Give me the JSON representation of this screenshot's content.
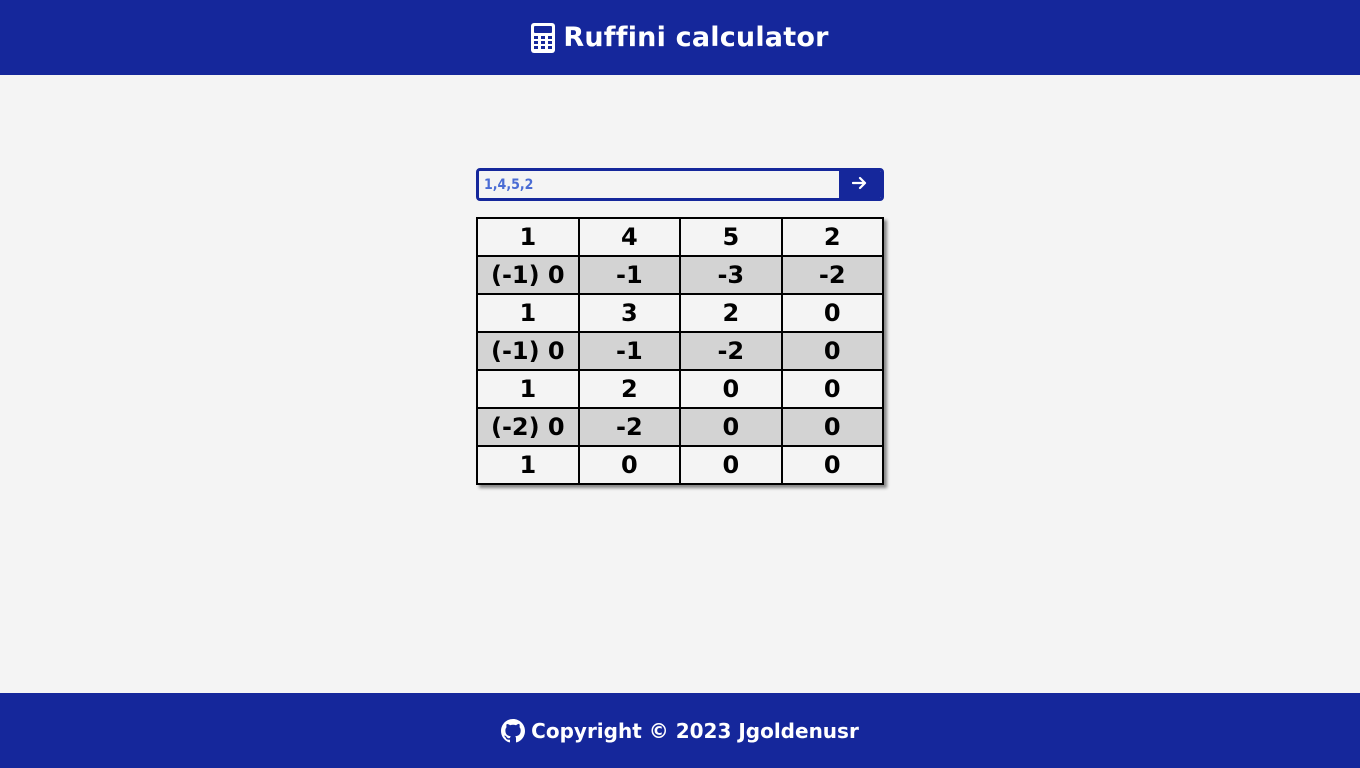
{
  "header": {
    "title": "Ruffini calculator",
    "icon": "calculator-icon"
  },
  "search": {
    "value": "1,4,5,2",
    "submit_icon": "arrow-right-icon"
  },
  "table": {
    "rows": [
      {
        "shaded": false,
        "cells": [
          "1",
          "4",
          "5",
          "2"
        ]
      },
      {
        "shaded": true,
        "cells": [
          "(-1) 0",
          "-1",
          "-3",
          "-2"
        ]
      },
      {
        "shaded": false,
        "cells": [
          "1",
          "3",
          "2",
          "0"
        ]
      },
      {
        "shaded": true,
        "cells": [
          "(-1) 0",
          "-1",
          "-2",
          "0"
        ]
      },
      {
        "shaded": false,
        "cells": [
          "1",
          "2",
          "0",
          "0"
        ]
      },
      {
        "shaded": true,
        "cells": [
          "(-2) 0",
          "-2",
          "0",
          "0"
        ]
      },
      {
        "shaded": false,
        "cells": [
          "1",
          "0",
          "0",
          "0"
        ]
      }
    ]
  },
  "footer": {
    "text": "Copyright © 2023 Jgoldenusr",
    "icon": "github-icon"
  },
  "colors": {
    "brand": "#15279b",
    "background": "#f4f4f4",
    "row_shade": "#d3d3d3",
    "input_text": "#4a6cd4"
  }
}
